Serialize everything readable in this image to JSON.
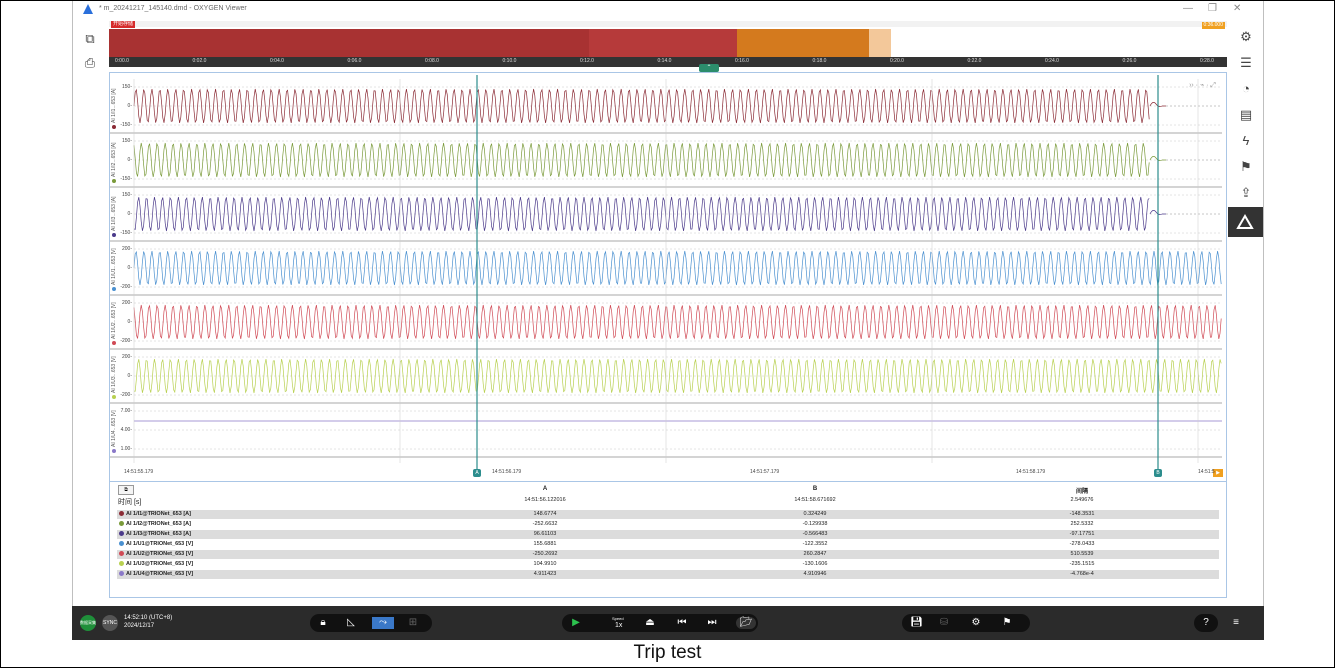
{
  "window": {
    "title": "* m_20241217_145140.dmd - OXYGEN Viewer",
    "minimize_glyph": "—",
    "restore_glyph": "❐",
    "close_glyph": "✕"
  },
  "overview": {
    "status_tag": "开始存储",
    "end_tag": "0:36.000",
    "axis_labels": [
      "0:00.0",
      "0:02.0",
      "0:04.0",
      "0:06.0",
      "0:08.0",
      "0:10.0",
      "0:12.0",
      "0:14.0",
      "0:16.0",
      "0:18.0",
      "0:20.0",
      "0:22.0",
      "0:24.0",
      "0:26.0",
      "0:28.0"
    ],
    "colors": {
      "stored": "#a83232",
      "stored_alt": "#b63a3a",
      "recent": "#d47a1e",
      "latest": "#f3c89a"
    },
    "collapse_glyph": "⌃"
  },
  "plot": {
    "channels": [
      {
        "label": "AI 1/I1...653 [A]",
        "color": "#8b2b35",
        "ticks": [
          "150-",
          "0-",
          "-150-"
        ]
      },
      {
        "label": "AI 1/I2...653 [A]",
        "color": "#7a9a3a",
        "ticks": [
          "150-",
          "0-",
          "-150-"
        ]
      },
      {
        "label": "AI 1/I3...653 [A]",
        "color": "#4b3a8a",
        "ticks": [
          "150-",
          "0-",
          "-150-"
        ]
      },
      {
        "label": "AI 1/U1...653 [V]",
        "color": "#4a90d0",
        "ticks": [
          "200-",
          "0-",
          "-200-"
        ]
      },
      {
        "label": "AI 1/U2...653 [V]",
        "color": "#d04a55",
        "ticks": [
          "200-",
          "0-",
          "-200-"
        ]
      },
      {
        "label": "AI 1/U3...653 [V]",
        "color": "#b8d050",
        "ticks": [
          "200-",
          "0-",
          "-200-"
        ]
      },
      {
        "label": "AI 1/U4...653 [V]",
        "color": "#8a78c8",
        "ticks": [
          "7.00-",
          "4.00-",
          "1.00-"
        ]
      }
    ],
    "x_labels": [
      "14:51:55.179",
      "14:51:56.179",
      "14:51:57.179",
      "14:51:58.179",
      "14:51:5"
    ],
    "cursor_a": "A",
    "cursor_b": "B",
    "tool_icons": "›› · ⌁ · ⤢",
    "end_marker": "▶"
  },
  "table": {
    "tool_button": "⧉",
    "headers": {
      "a": "A",
      "b": "B",
      "diff": "间隔"
    },
    "time_label": "时间 [s]",
    "time_a": "14:51:56.122016",
    "time_b": "14:51:58.671692",
    "time_diff": "2.549676",
    "rows": [
      {
        "name": "AI 1/I1@TRIONet_653 [A]",
        "color": "#8b2b35",
        "a": "148.6774",
        "b": "0.324249",
        "diff": "-148.3531"
      },
      {
        "name": "AI 1/I2@TRIONet_653 [A]",
        "color": "#7a9a3a",
        "a": "-252.6632",
        "b": "-0.129938",
        "diff": "252.5332"
      },
      {
        "name": "AI 1/I3@TRIONet_653 [A]",
        "color": "#4b3a8a",
        "a": "96.61103",
        "b": "-0.566483",
        "diff": "-97.17751"
      },
      {
        "name": "AI 1/U1@TRIONet_653 [V]",
        "color": "#4a90d0",
        "a": "155.6881",
        "b": "-122.3552",
        "diff": "-278.0433"
      },
      {
        "name": "AI 1/U2@TRIONet_653 [V]",
        "color": "#d04a55",
        "a": "-250.2692",
        "b": "260.2847",
        "diff": "510.5539"
      },
      {
        "name": "AI 1/U3@TRIONet_653 [V]",
        "color": "#b8d050",
        "a": "104.9910",
        "b": "-130.1606",
        "diff": "-235.1515"
      },
      {
        "name": "AI 1/U4@TRIONet_653 [V]",
        "color": "#8a78c8",
        "a": "4.911423",
        "b": "4.910946",
        "diff": "-4.768e-4"
      }
    ]
  },
  "taskbar": {
    "status_badge": "数据采集",
    "sync_label": "SYNC",
    "time": "14:52:10 (UTC+8)",
    "date": "2024/12/17",
    "speed_label": "Speed",
    "speed_value": "1x"
  },
  "caption": "Trip test"
}
